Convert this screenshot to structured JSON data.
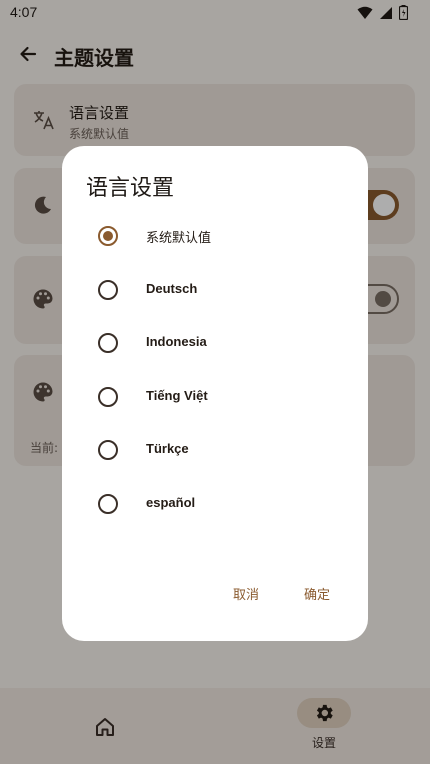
{
  "status_bar": {
    "time": "4:07"
  },
  "header": {
    "title": "主题设置"
  },
  "cards": [
    {
      "title": "语言设置",
      "subtitle": "系统默认值"
    },
    {
      "toggle": true
    },
    {
      "toggle": false
    },
    {
      "extra": "当前:"
    }
  ],
  "bottom_nav": {
    "settings_label": "设置"
  },
  "dialog": {
    "title": "语言设置",
    "options": [
      {
        "label": "系统默认值",
        "selected": true
      },
      {
        "label": "Deutsch",
        "selected": false
      },
      {
        "label": "Indonesia",
        "selected": false
      },
      {
        "label": "Tiếng Việt",
        "selected": false
      },
      {
        "label": "Türkçe",
        "selected": false
      },
      {
        "label": "español",
        "selected": false
      }
    ],
    "cancel_label": "取消",
    "confirm_label": "确定"
  },
  "colors": {
    "accent": "#8a5a2e",
    "surface": "#ffffff",
    "background": "#f8f3ee"
  },
  "icons": [
    "wifi-icon",
    "signal-icon",
    "battery-icon",
    "back-arrow-icon",
    "translate-icon",
    "moon-icon",
    "palette-icon",
    "home-icon",
    "gear-icon"
  ]
}
